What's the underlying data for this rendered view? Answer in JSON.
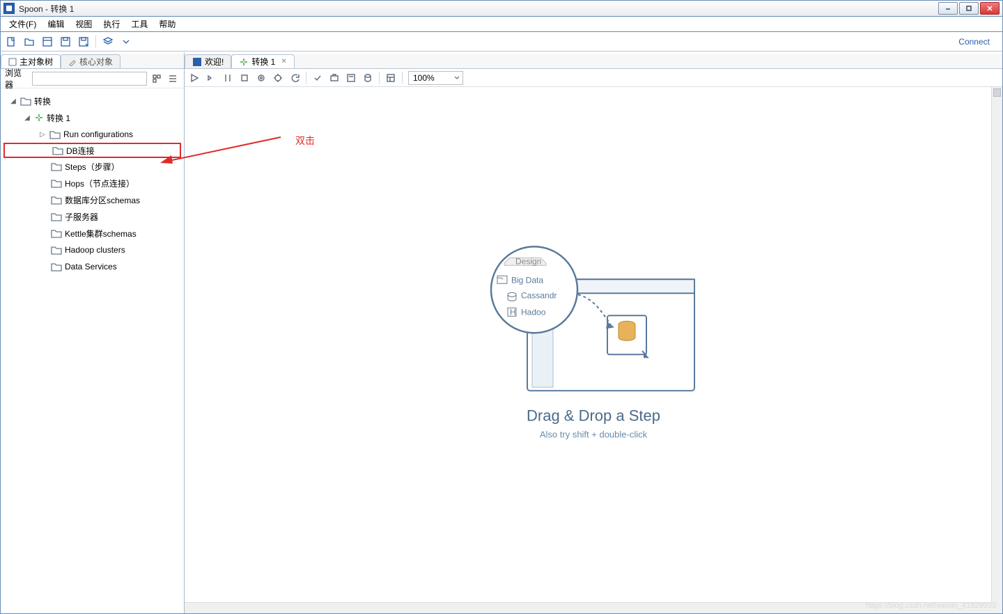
{
  "window": {
    "title": "Spoon - 转换 1"
  },
  "menu": {
    "file": "文件(F)",
    "edit": "编辑",
    "view": "视图",
    "run": "执行",
    "tools": "工具",
    "help": "帮助"
  },
  "toolbar": {
    "connect": "Connect"
  },
  "side_tabs": {
    "main_tree": "主对象树",
    "core_objects": "核心对象"
  },
  "browser": {
    "label": "浏览器",
    "value": ""
  },
  "tree": {
    "root": "转换",
    "trans1": "转换 1",
    "items": [
      "Run configurations",
      "DB连接",
      "Steps（步骤）",
      "Hops（节点连接）",
      "数据库分区schemas",
      "子服务器",
      "Kettle集群schemas",
      "Hadoop clusters",
      "Data Services"
    ]
  },
  "annotation": {
    "label": "双击"
  },
  "editor_tabs": {
    "welcome": "欢迎!",
    "trans1": "转换 1"
  },
  "editor_toolbar": {
    "zoom": "100%"
  },
  "placeholder": {
    "design_tab": "Design",
    "items": [
      "Big Data",
      "Cassandr",
      "Hadoo"
    ],
    "title": "Drag & Drop a Step",
    "subtitle": "Also try shift + double-click"
  },
  "watermark": "https://blog.csdn.net/weixin_41829033"
}
